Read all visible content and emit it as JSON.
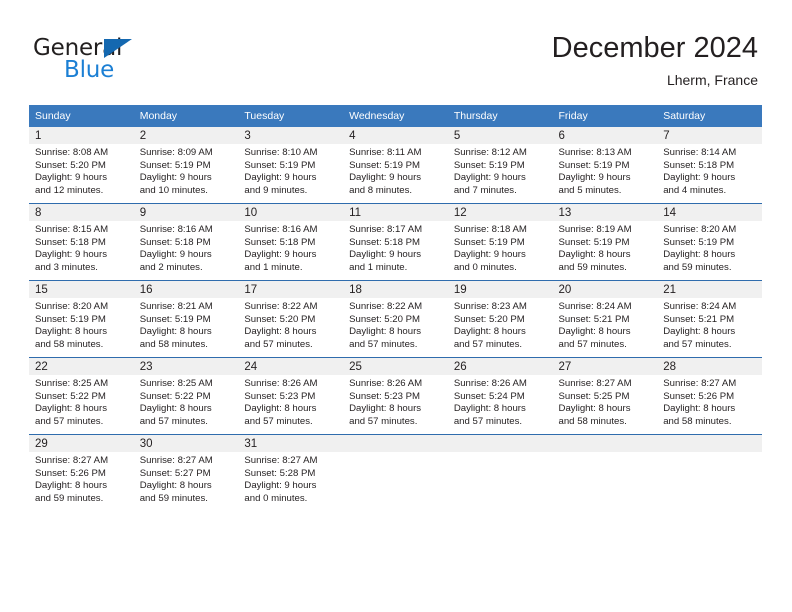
{
  "brand": {
    "name_top": "General",
    "name_bottom": "Blue",
    "accent_color": "#1b7fd4",
    "triangle_color": "#1468b0"
  },
  "header": {
    "title": "December 2024",
    "location": "Lherm, France"
  },
  "table": {
    "header_bg": "#3a79bd",
    "row_divider_color": "#2f6cad",
    "daynum_band_color": "#f0f0f0",
    "weekday_headers": [
      "Sunday",
      "Monday",
      "Tuesday",
      "Wednesday",
      "Thursday",
      "Friday",
      "Saturday"
    ]
  },
  "weeks": [
    [
      {
        "day": "1",
        "sunrise": "Sunrise: 8:08 AM",
        "sunset": "Sunset: 5:20 PM",
        "daylight_line1": "Daylight: 9 hours",
        "daylight_line2": "and 12 minutes."
      },
      {
        "day": "2",
        "sunrise": "Sunrise: 8:09 AM",
        "sunset": "Sunset: 5:19 PM",
        "daylight_line1": "Daylight: 9 hours",
        "daylight_line2": "and 10 minutes."
      },
      {
        "day": "3",
        "sunrise": "Sunrise: 8:10 AM",
        "sunset": "Sunset: 5:19 PM",
        "daylight_line1": "Daylight: 9 hours",
        "daylight_line2": "and 9 minutes."
      },
      {
        "day": "4",
        "sunrise": "Sunrise: 8:11 AM",
        "sunset": "Sunset: 5:19 PM",
        "daylight_line1": "Daylight: 9 hours",
        "daylight_line2": "and 8 minutes."
      },
      {
        "day": "5",
        "sunrise": "Sunrise: 8:12 AM",
        "sunset": "Sunset: 5:19 PM",
        "daylight_line1": "Daylight: 9 hours",
        "daylight_line2": "and 7 minutes."
      },
      {
        "day": "6",
        "sunrise": "Sunrise: 8:13 AM",
        "sunset": "Sunset: 5:19 PM",
        "daylight_line1": "Daylight: 9 hours",
        "daylight_line2": "and 5 minutes."
      },
      {
        "day": "7",
        "sunrise": "Sunrise: 8:14 AM",
        "sunset": "Sunset: 5:18 PM",
        "daylight_line1": "Daylight: 9 hours",
        "daylight_line2": "and 4 minutes."
      }
    ],
    [
      {
        "day": "8",
        "sunrise": "Sunrise: 8:15 AM",
        "sunset": "Sunset: 5:18 PM",
        "daylight_line1": "Daylight: 9 hours",
        "daylight_line2": "and 3 minutes."
      },
      {
        "day": "9",
        "sunrise": "Sunrise: 8:16 AM",
        "sunset": "Sunset: 5:18 PM",
        "daylight_line1": "Daylight: 9 hours",
        "daylight_line2": "and 2 minutes."
      },
      {
        "day": "10",
        "sunrise": "Sunrise: 8:16 AM",
        "sunset": "Sunset: 5:18 PM",
        "daylight_line1": "Daylight: 9 hours",
        "daylight_line2": "and 1 minute."
      },
      {
        "day": "11",
        "sunrise": "Sunrise: 8:17 AM",
        "sunset": "Sunset: 5:18 PM",
        "daylight_line1": "Daylight: 9 hours",
        "daylight_line2": "and 1 minute."
      },
      {
        "day": "12",
        "sunrise": "Sunrise: 8:18 AM",
        "sunset": "Sunset: 5:19 PM",
        "daylight_line1": "Daylight: 9 hours",
        "daylight_line2": "and 0 minutes."
      },
      {
        "day": "13",
        "sunrise": "Sunrise: 8:19 AM",
        "sunset": "Sunset: 5:19 PM",
        "daylight_line1": "Daylight: 8 hours",
        "daylight_line2": "and 59 minutes."
      },
      {
        "day": "14",
        "sunrise": "Sunrise: 8:20 AM",
        "sunset": "Sunset: 5:19 PM",
        "daylight_line1": "Daylight: 8 hours",
        "daylight_line2": "and 59 minutes."
      }
    ],
    [
      {
        "day": "15",
        "sunrise": "Sunrise: 8:20 AM",
        "sunset": "Sunset: 5:19 PM",
        "daylight_line1": "Daylight: 8 hours",
        "daylight_line2": "and 58 minutes."
      },
      {
        "day": "16",
        "sunrise": "Sunrise: 8:21 AM",
        "sunset": "Sunset: 5:19 PM",
        "daylight_line1": "Daylight: 8 hours",
        "daylight_line2": "and 58 minutes."
      },
      {
        "day": "17",
        "sunrise": "Sunrise: 8:22 AM",
        "sunset": "Sunset: 5:20 PM",
        "daylight_line1": "Daylight: 8 hours",
        "daylight_line2": "and 57 minutes."
      },
      {
        "day": "18",
        "sunrise": "Sunrise: 8:22 AM",
        "sunset": "Sunset: 5:20 PM",
        "daylight_line1": "Daylight: 8 hours",
        "daylight_line2": "and 57 minutes."
      },
      {
        "day": "19",
        "sunrise": "Sunrise: 8:23 AM",
        "sunset": "Sunset: 5:20 PM",
        "daylight_line1": "Daylight: 8 hours",
        "daylight_line2": "and 57 minutes."
      },
      {
        "day": "20",
        "sunrise": "Sunrise: 8:24 AM",
        "sunset": "Sunset: 5:21 PM",
        "daylight_line1": "Daylight: 8 hours",
        "daylight_line2": "and 57 minutes."
      },
      {
        "day": "21",
        "sunrise": "Sunrise: 8:24 AM",
        "sunset": "Sunset: 5:21 PM",
        "daylight_line1": "Daylight: 8 hours",
        "daylight_line2": "and 57 minutes."
      }
    ],
    [
      {
        "day": "22",
        "sunrise": "Sunrise: 8:25 AM",
        "sunset": "Sunset: 5:22 PM",
        "daylight_line1": "Daylight: 8 hours",
        "daylight_line2": "and 57 minutes."
      },
      {
        "day": "23",
        "sunrise": "Sunrise: 8:25 AM",
        "sunset": "Sunset: 5:22 PM",
        "daylight_line1": "Daylight: 8 hours",
        "daylight_line2": "and 57 minutes."
      },
      {
        "day": "24",
        "sunrise": "Sunrise: 8:26 AM",
        "sunset": "Sunset: 5:23 PM",
        "daylight_line1": "Daylight: 8 hours",
        "daylight_line2": "and 57 minutes."
      },
      {
        "day": "25",
        "sunrise": "Sunrise: 8:26 AM",
        "sunset": "Sunset: 5:23 PM",
        "daylight_line1": "Daylight: 8 hours",
        "daylight_line2": "and 57 minutes."
      },
      {
        "day": "26",
        "sunrise": "Sunrise: 8:26 AM",
        "sunset": "Sunset: 5:24 PM",
        "daylight_line1": "Daylight: 8 hours",
        "daylight_line2": "and 57 minutes."
      },
      {
        "day": "27",
        "sunrise": "Sunrise: 8:27 AM",
        "sunset": "Sunset: 5:25 PM",
        "daylight_line1": "Daylight: 8 hours",
        "daylight_line2": "and 58 minutes."
      },
      {
        "day": "28",
        "sunrise": "Sunrise: 8:27 AM",
        "sunset": "Sunset: 5:26 PM",
        "daylight_line1": "Daylight: 8 hours",
        "daylight_line2": "and 58 minutes."
      }
    ],
    [
      {
        "day": "29",
        "sunrise": "Sunrise: 8:27 AM",
        "sunset": "Sunset: 5:26 PM",
        "daylight_line1": "Daylight: 8 hours",
        "daylight_line2": "and 59 minutes."
      },
      {
        "day": "30",
        "sunrise": "Sunrise: 8:27 AM",
        "sunset": "Sunset: 5:27 PM",
        "daylight_line1": "Daylight: 8 hours",
        "daylight_line2": "and 59 minutes."
      },
      {
        "day": "31",
        "sunrise": "Sunrise: 8:27 AM",
        "sunset": "Sunset: 5:28 PM",
        "daylight_line1": "Daylight: 9 hours",
        "daylight_line2": "and 0 minutes."
      },
      {
        "day": "",
        "sunrise": "",
        "sunset": "",
        "daylight_line1": "",
        "daylight_line2": ""
      },
      {
        "day": "",
        "sunrise": "",
        "sunset": "",
        "daylight_line1": "",
        "daylight_line2": ""
      },
      {
        "day": "",
        "sunrise": "",
        "sunset": "",
        "daylight_line1": "",
        "daylight_line2": ""
      },
      {
        "day": "",
        "sunrise": "",
        "sunset": "",
        "daylight_line1": "",
        "daylight_line2": ""
      }
    ]
  ]
}
